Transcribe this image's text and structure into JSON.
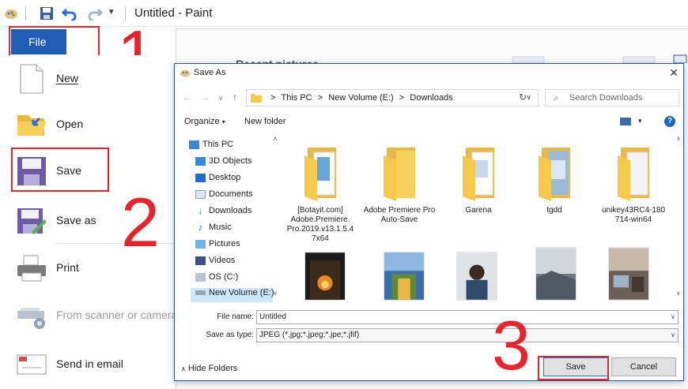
{
  "paint": {
    "window_title": "Untitled - Paint",
    "file_tab": "File",
    "recent_title": "Recent pictures",
    "menu": [
      {
        "label": "New"
      },
      {
        "label": "Open"
      },
      {
        "label": "Save"
      },
      {
        "label": "Save as"
      },
      {
        "label": "Print"
      },
      {
        "label": "From scanner or camera",
        "disabled": true
      },
      {
        "label": "Send in email"
      }
    ]
  },
  "annotations": {
    "step1": "1",
    "step2": "2",
    "step3": "3",
    "color": "#e3262e"
  },
  "dialog": {
    "title": "Save As",
    "close": "✕",
    "address": {
      "path_this_pc": "This PC",
      "path_volume": "New Volume (E:)",
      "path_downloads": "Downloads",
      "separator": ">"
    },
    "search_placeholder": "Search Downloads",
    "organize": "Organize",
    "new_folder": "New folder",
    "help": "?",
    "nav_items": [
      {
        "label": "This PC"
      },
      {
        "label": "3D Objects"
      },
      {
        "label": "Desktop"
      },
      {
        "label": "Documents"
      },
      {
        "label": "Downloads"
      },
      {
        "label": "Music"
      },
      {
        "label": "Pictures"
      },
      {
        "label": "Videos"
      },
      {
        "label": "OS (C:)"
      },
      {
        "label": "New Volume (E:)"
      }
    ],
    "folders": [
      {
        "label": "[Botayit.com] Adobe.Premiere. Pro.2019.v13.1.5.4 7x64"
      },
      {
        "label": "Adobe Premiere Pro Auto-Save"
      },
      {
        "label": "Garena"
      },
      {
        "label": "tgdd"
      },
      {
        "label": "unikey43RC4-180 714-win64"
      }
    ],
    "file_name_label": "File name:",
    "file_name_value": "Untitled",
    "save_type_label": "Save as type:",
    "save_type_value": "JPEG (*.jpg;*.jpeg;*.jpe;*.jfif)",
    "hide_folders": "Hide Folders",
    "save_button": "Save",
    "cancel_button": "Cancel",
    "accent": "#0078d7",
    "folder_color": "#f5c94c"
  }
}
